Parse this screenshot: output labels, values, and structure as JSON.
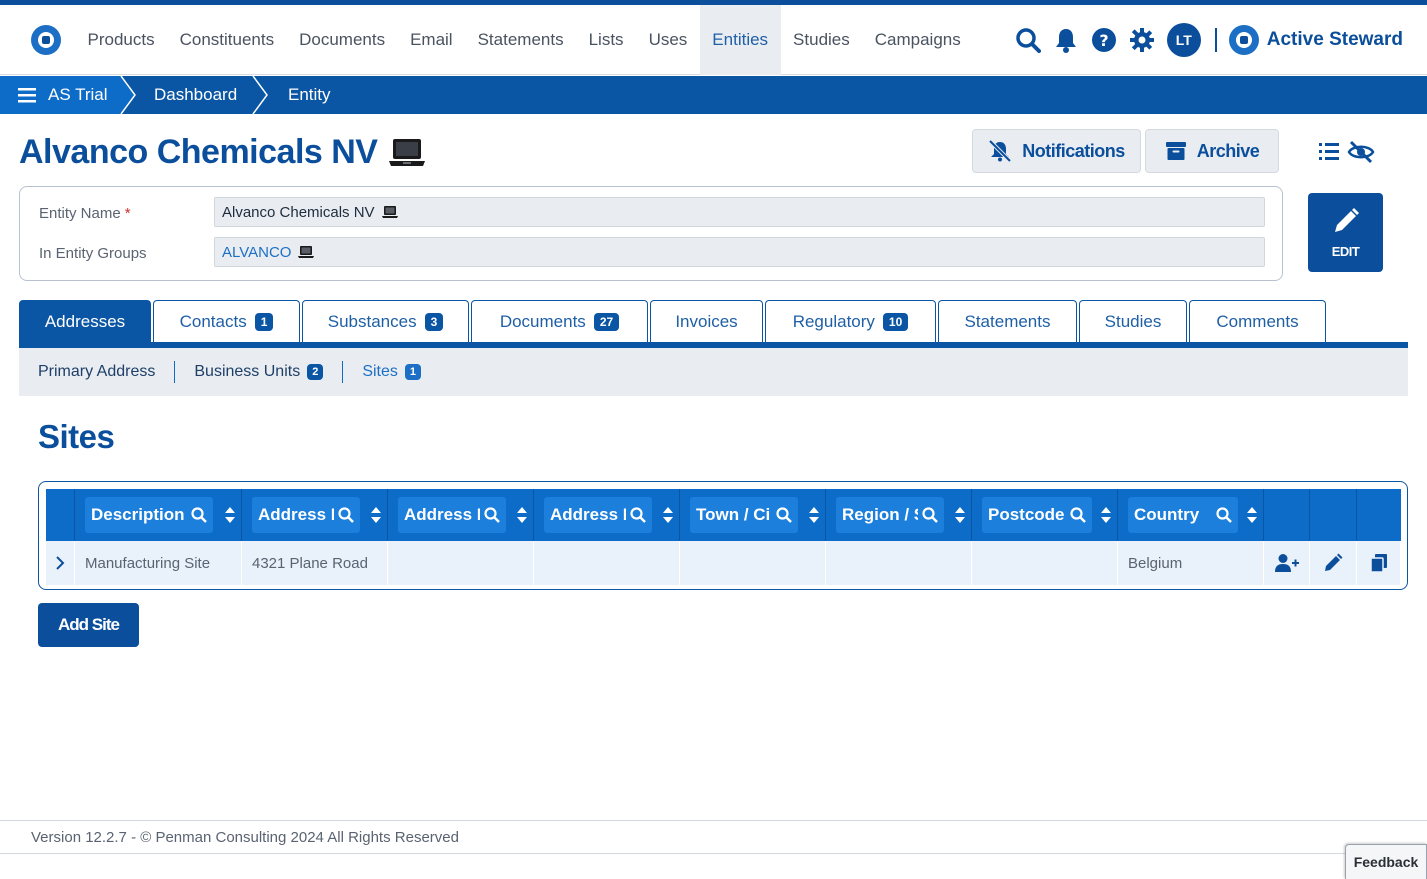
{
  "nav": {
    "items": [
      {
        "label": "Products",
        "active": false
      },
      {
        "label": "Constituents",
        "active": false
      },
      {
        "label": "Documents",
        "active": false
      },
      {
        "label": "Email",
        "active": false
      },
      {
        "label": "Statements",
        "active": false
      },
      {
        "label": "Lists",
        "active": false
      },
      {
        "label": "Uses",
        "active": false
      },
      {
        "label": "Entities",
        "active": true
      },
      {
        "label": "Studies",
        "active": false
      },
      {
        "label": "Campaigns",
        "active": false
      }
    ],
    "avatar_initials": "LT",
    "brand": "Active Steward"
  },
  "breadcrumb": {
    "items": [
      "AS Trial",
      "Dashboard",
      "Entity"
    ]
  },
  "entity": {
    "title": "Alvanco Chemicals NV",
    "notifications_label": "Notifications",
    "archive_label": "Archive",
    "edit_label": "EDIT",
    "fields": {
      "name_label": "Entity Name",
      "name_required": "*",
      "name_value": "Alvanco Chemicals NV",
      "groups_label": "In Entity Groups",
      "groups_value": "ALVANCO"
    }
  },
  "tabs": [
    {
      "label": "Addresses",
      "badge": "",
      "active": true
    },
    {
      "label": "Contacts",
      "badge": "1",
      "active": false
    },
    {
      "label": "Substances",
      "badge": "3",
      "active": false
    },
    {
      "label": "Documents",
      "badge": "27",
      "active": false
    },
    {
      "label": "Invoices",
      "badge": "",
      "active": false
    },
    {
      "label": "Regulatory",
      "badge": "10",
      "active": false
    },
    {
      "label": "Statements",
      "badge": "",
      "active": false
    },
    {
      "label": "Studies",
      "badge": "",
      "active": false
    },
    {
      "label": "Comments",
      "badge": "",
      "active": false
    }
  ],
  "subtabs": [
    {
      "label": "Primary Address",
      "badge": "",
      "active": false
    },
    {
      "label": "Business Units",
      "badge": "2",
      "active": false
    },
    {
      "label": "Sites",
      "badge": "1",
      "active": true
    }
  ],
  "section": {
    "title": "Sites"
  },
  "table": {
    "columns": [
      "Description",
      "Address L",
      "Address L",
      "Address L",
      "Town / Ci",
      "Region / S",
      "Postcode",
      "Country"
    ],
    "rows": [
      [
        "Manufacturing Site",
        "4321 Plane Road",
        "",
        "",
        "",
        "",
        "",
        "Belgium"
      ]
    ]
  },
  "add_button": "Add Site",
  "footer": {
    "text": "Version 12.2.7 - © Penman Consulting 2024 All Rights Reserved",
    "feedback": "Feedback"
  },
  "colors": {
    "primary": "#0b4f9c",
    "accent": "#0d6cc8",
    "light_bg": "#e9edf2"
  }
}
